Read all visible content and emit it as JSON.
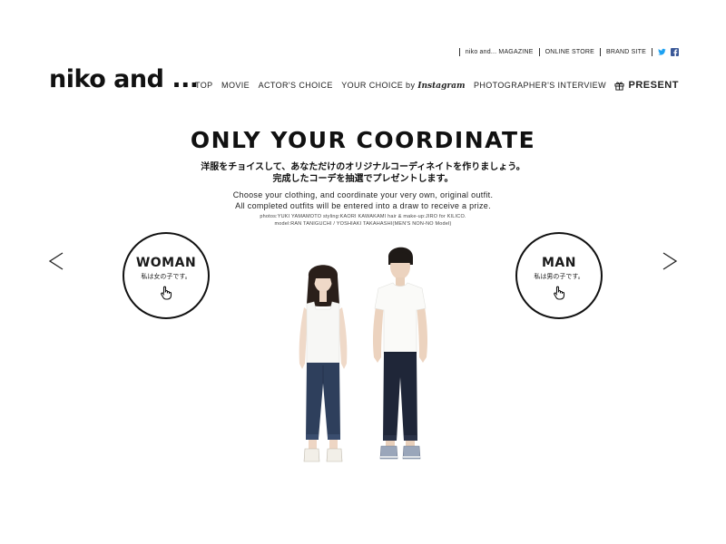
{
  "header": {
    "utility_links": [
      "niko and... MAGAZINE",
      "ONLINE STORE",
      "BRAND SITE"
    ],
    "social_icons": [
      "twitter-icon",
      "facebook-icon"
    ],
    "twitter_color": "#1da1f2",
    "facebook_color": "#3b5998",
    "logo": "niko and ...",
    "nav": {
      "top": "TOP",
      "movie": "MOVIE",
      "actors_choice": "ACTOR'S CHOICE",
      "your_choice": "YOUR CHOICE by",
      "instagram": "Instagram",
      "photographers_interview": "PHOTOGRAPHER'S INTERVIEW",
      "present": "PRESENT"
    }
  },
  "main": {
    "title": "ONLY YOUR COORDINATE",
    "jp_line1": "洋服をチョイスして、あなただけのオリジナルコーディネイトを作りましょう。",
    "jp_line2": "完成したコーデを抽選でプレゼントします。",
    "en_line1": "Choose your clothing, and coordinate your very own, original outfit.",
    "en_line2": "All completed outfits will be entered into a draw to receive a prize.",
    "credit_line1": "photos:YUKI YAMAMOTO   styling:KAORI KAWAKAMI   hair & make-up:JIRO for KILICO.",
    "credit_line2": "model:RAN TANIGUCHI / YOSHIAKI TAKAHASHI(MEN'S NON-NO Model)"
  },
  "selector": {
    "woman_label": "WOMAN",
    "woman_sub": "私は女の子です。",
    "man_label": "MAN",
    "man_sub": "私は男の子です。"
  }
}
